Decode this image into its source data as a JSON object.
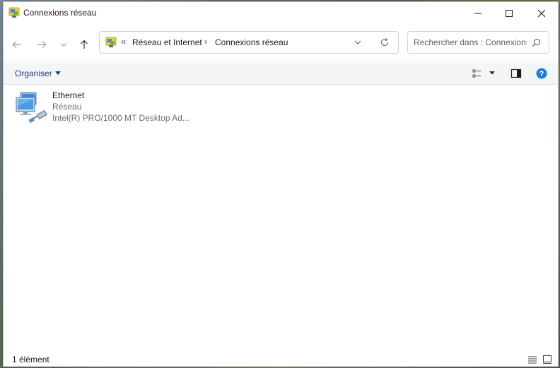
{
  "window": {
    "title": "Connexions réseau",
    "caption_buttons": [
      "minimize-icon",
      "maximize-icon",
      "close-icon"
    ]
  },
  "nav": {
    "back_icon": "arrow-left-icon",
    "forward_icon": "arrow-right-icon",
    "recent_icon": "chevron-down-icon",
    "up_icon": "arrow-up-icon",
    "breadcrumb_prefix": "«",
    "breadcrumb": [
      "Réseau et Internet",
      "Connexions réseau"
    ],
    "separator": "›",
    "search_placeholder": "Rechercher dans : Connexions réseau"
  },
  "toolbar": {
    "organiser_label": "Organiser",
    "view_icon": "view-options-icon",
    "preview_pane_icon": "preview-pane-icon",
    "help_icon": "help-icon"
  },
  "items": [
    {
      "name": "Ethernet",
      "status": "Réseau",
      "adapter": "Intel(R) PRO/1000 MT Desktop Ad..."
    }
  ],
  "status": {
    "count": "1 élément"
  },
  "colors": {
    "accent": "#0067c0",
    "help": "#1c7ed6",
    "link": "#1b3f7a"
  }
}
